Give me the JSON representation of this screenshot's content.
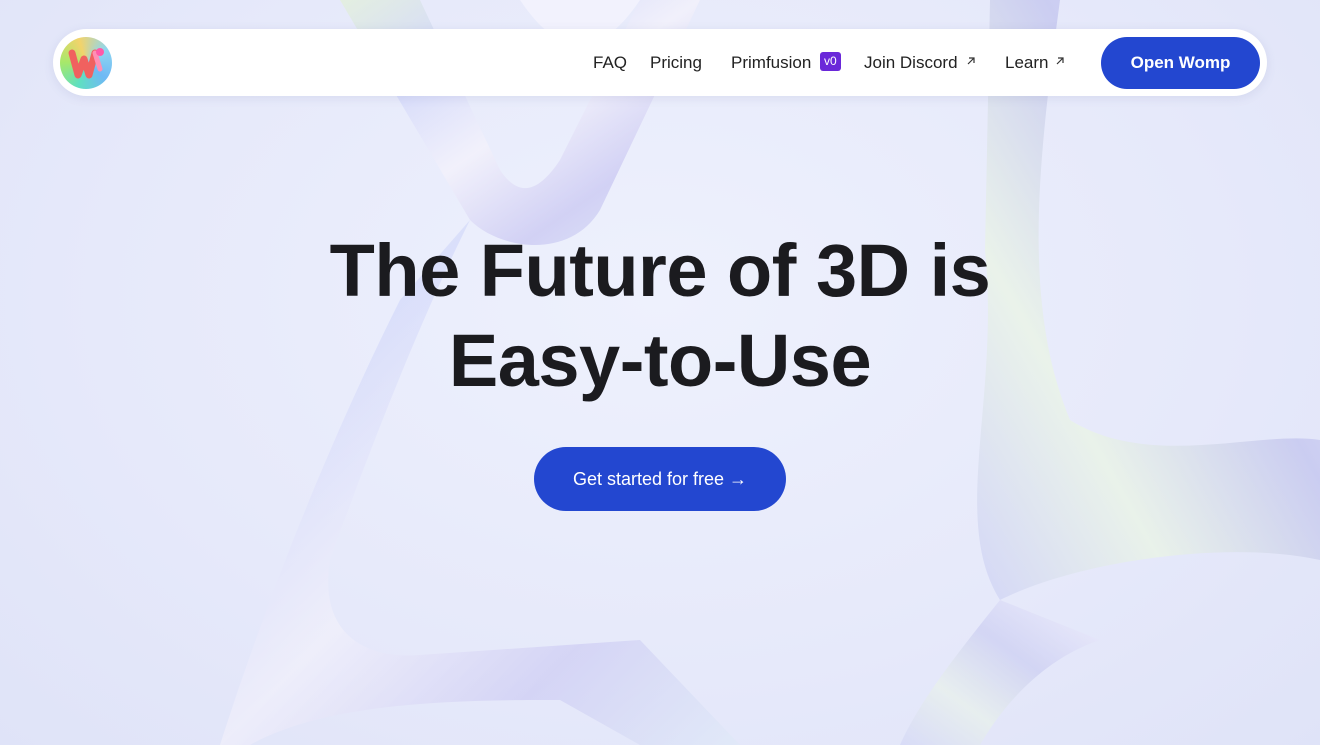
{
  "nav": {
    "logo_alt": "Womp logo",
    "links": [
      {
        "label": "FAQ"
      },
      {
        "label": "Pricing"
      },
      {
        "label": "Primfusion",
        "badge": "v0"
      },
      {
        "label": "Join Discord",
        "icon": "external-arrow-icon"
      },
      {
        "label": "Learn",
        "icon": "external-arrow-icon"
      }
    ],
    "open_button": "Open Womp"
  },
  "hero": {
    "title_line1": "The Future of 3D is",
    "title_line2": "Easy-to-Use",
    "cta": "Get started for free →"
  },
  "colors": {
    "primary": "#2347d0",
    "badge": "#6a28d9",
    "text": "#1b1b1f",
    "background": "#e9ecfb"
  }
}
